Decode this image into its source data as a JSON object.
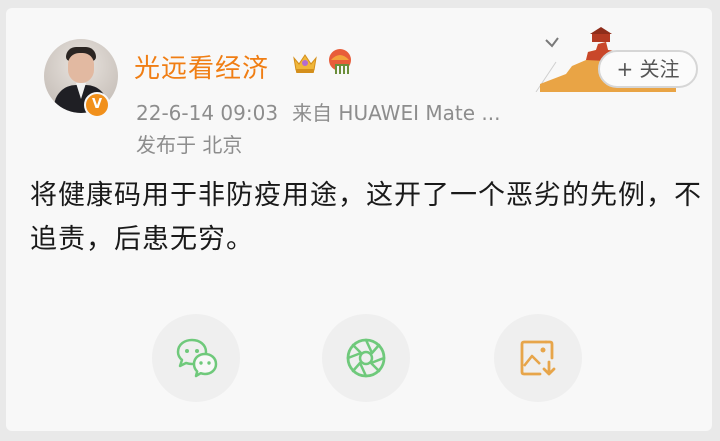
{
  "post": {
    "author": "光远看经济",
    "timestamp": "22-6-14 09:03",
    "source": "来自 HUAWEI Mate ...",
    "location": "发布于 北京",
    "content": "将健康码用于非防疫用途，这开了一个恶劣的先例，不追责，后患无穷。",
    "verified_badge": "V"
  },
  "follow": {
    "label": "+ 关注"
  },
  "share": [
    {
      "icon": "wechat-icon"
    },
    {
      "icon": "moments-icon"
    },
    {
      "icon": "save-image-icon"
    }
  ],
  "colors": {
    "username": "#f07e14",
    "meta": "#8d8d8d",
    "background": "#f8f8f8",
    "wechat_green": "#6fc97b",
    "save_orange": "#e7a54a"
  }
}
